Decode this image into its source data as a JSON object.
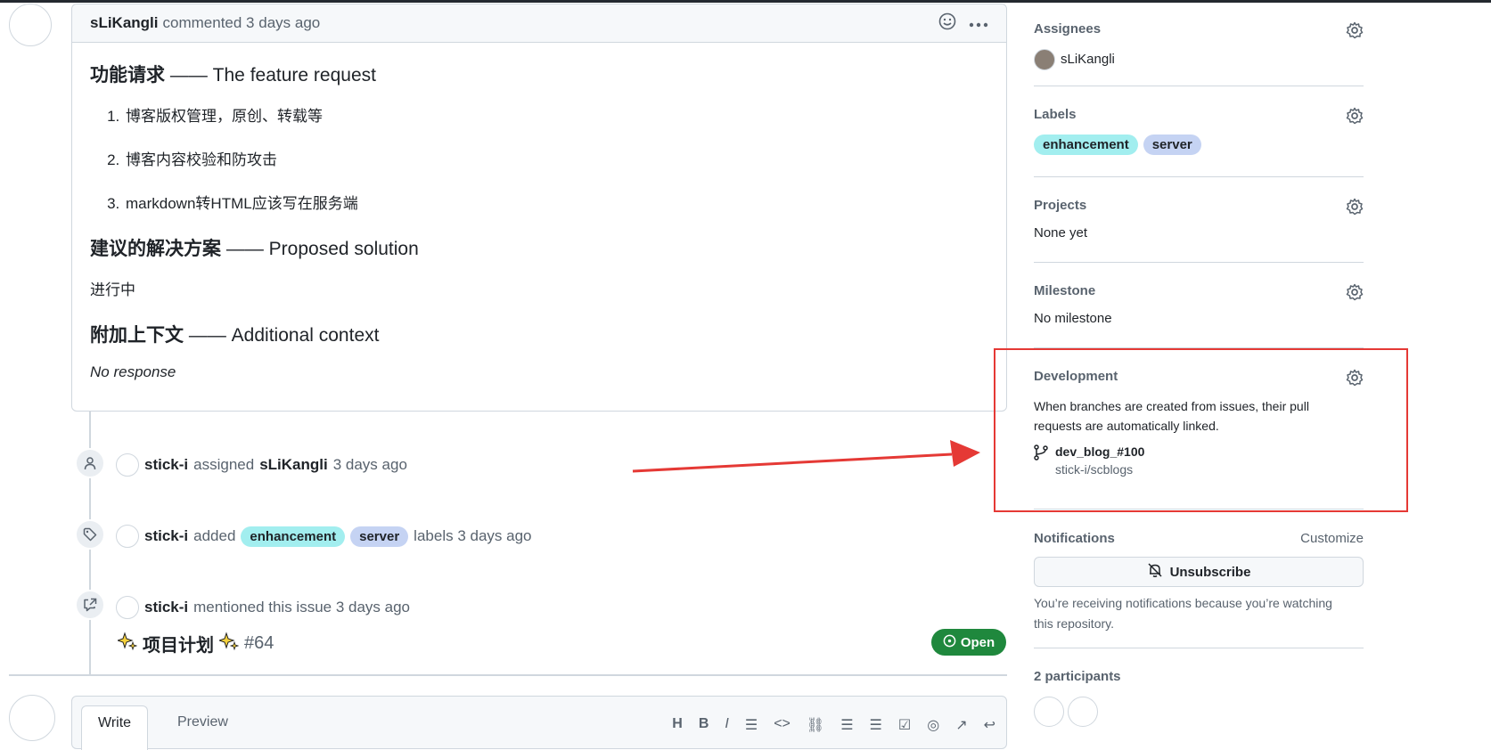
{
  "comment": {
    "author": "sLiKangli",
    "action": "commented 3 days ago",
    "sections": [
      {
        "title_cn": "功能请求",
        "title_en": "—— The feature request"
      },
      {
        "title_cn": "建议的解决方案",
        "title_en": "—— Proposed solution"
      },
      {
        "title_cn": "附加上下文",
        "title_en": "—— Additional context"
      }
    ],
    "list": [
      "博客版权管理，原创、转载等",
      "博客内容校验和防攻击",
      "markdown转HTML应该写在服务端"
    ],
    "solution_text": "进行中",
    "context_text": "No response"
  },
  "timeline": {
    "assign": {
      "actor": "stick-i",
      "verb": "assigned",
      "target": "sLiKangli",
      "time": "3 days ago"
    },
    "labels": {
      "actor": "stick-i",
      "verb": "added",
      "suffix": "labels 3 days ago"
    },
    "mention": {
      "actor": "stick-i",
      "text": "mentioned this issue 3 days ago"
    },
    "ref": {
      "title": "项目计划",
      "number": "#64",
      "state": "Open"
    }
  },
  "labels": {
    "enhancement": {
      "name": "enhancement",
      "color": "#a2eeef"
    },
    "server": {
      "name": "server",
      "color": "#c5d3f3"
    }
  },
  "editor": {
    "tab_write": "Write",
    "tab_preview": "Preview"
  },
  "sidebar": {
    "assignees": {
      "title": "Assignees",
      "user": "sLiKangli"
    },
    "labels": {
      "title": "Labels"
    },
    "projects": {
      "title": "Projects",
      "value": "None yet"
    },
    "milestone": {
      "title": "Milestone",
      "value": "No milestone"
    },
    "development": {
      "title": "Development",
      "desc": "When branches are created from issues, their pull requests are automatically linked.",
      "branch": "dev_blog_#100",
      "repo": "stick-i/scblogs"
    },
    "notifications": {
      "title": "Notifications",
      "customize": "Customize",
      "button": "Unsubscribe",
      "note": "You’re receiving notifications because you’re watching this repository."
    },
    "participants": {
      "title": "2 participants"
    }
  }
}
